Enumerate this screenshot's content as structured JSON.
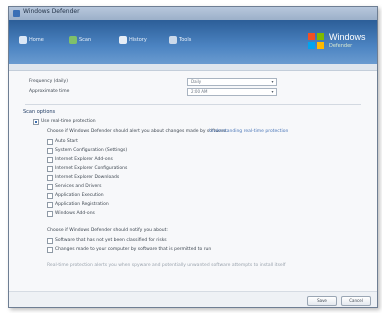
{
  "window": {
    "title": "Windows Defender"
  },
  "toolbar": {
    "items": [
      {
        "label": "Home"
      },
      {
        "label": "Scan"
      },
      {
        "label": "History"
      },
      {
        "label": "Tools"
      }
    ],
    "logo_text": "Windows",
    "logo_sub": "Defender"
  },
  "settings": {
    "frequency_label": "Frequency (daily)",
    "frequency_value": "Daily",
    "time_label": "Approximate time",
    "time_value": "2:00 AM",
    "section_heading": "Scan options",
    "main_option": "Use real-time protection",
    "main_desc": "Choose if Windows Defender should alert you about changes made by software.",
    "link": "Understanding real-time protection",
    "options": [
      "Auto Start",
      "System Configuration (Settings)",
      "Internet Explorer Add-ons",
      "Internet Explorer Configurations",
      "Internet Explorer Downloads",
      "Services and Drivers",
      "Application Execution",
      "Application Registration",
      "Windows Add-ons"
    ],
    "extra_heading": "Choose if Windows Defender should notify you about:",
    "extra_options": [
      "Software that has not yet been classified for risks",
      "Changes made to your computer by software that is permitted to run"
    ],
    "footer_note": "Real-time protection alerts you when spyware and potentially unwanted software attempts to install itself"
  },
  "footer": {
    "save_label": "Save",
    "cancel_label": "Cancel"
  },
  "colors": {
    "toolbar": "#3b6fab",
    "accent": "#3b6db0"
  }
}
